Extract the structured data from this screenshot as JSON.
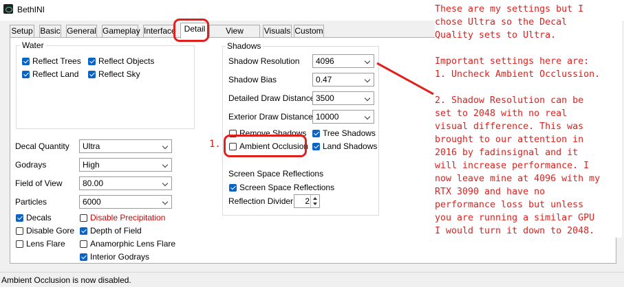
{
  "window": {
    "title": "BethINI",
    "close_glyph": "✕"
  },
  "tabs": [
    "Setup",
    "Basic",
    "General",
    "Gameplay",
    "Interface",
    "Detail",
    "View Distance",
    "Visuals",
    "Custom"
  ],
  "active_tab": "Detail",
  "water": {
    "title": "Water",
    "items": [
      {
        "label": "Reflect Trees",
        "checked": true
      },
      {
        "label": "Reflect Objects",
        "checked": true
      },
      {
        "label": "Reflect Land",
        "checked": true
      },
      {
        "label": "Reflect Sky",
        "checked": true
      }
    ]
  },
  "detail": {
    "decal_quantity": {
      "label": "Decal Quantity",
      "value": "Ultra"
    },
    "godrays": {
      "label": "Godrays",
      "value": "High"
    },
    "field_of_view": {
      "label": "Field of View",
      "value": "80.00"
    },
    "particles": {
      "label": "Particles",
      "value": "6000"
    }
  },
  "misc_checks": [
    {
      "label": "Decals",
      "checked": true
    },
    {
      "label": "Disable Precipitation",
      "checked": false
    },
    {
      "label": "Disable Gore",
      "checked": false
    },
    {
      "label": "Depth of Field",
      "checked": true
    },
    {
      "label": "Lens Flare",
      "checked": false
    },
    {
      "label": "Anamorphic Lens Flare",
      "checked": false
    },
    {
      "label": "Interior Godrays",
      "checked": true
    }
  ],
  "shadows": {
    "title": "Shadows",
    "resolution": {
      "label": "Shadow Resolution",
      "value": "4096"
    },
    "bias": {
      "label": "Shadow Bias",
      "value": "0.47"
    },
    "detailed_draw": {
      "label": "Detailed Draw Distance",
      "value": "3500"
    },
    "exterior_draw": {
      "label": "Exterior Draw Distance",
      "value": "10000"
    },
    "checks": [
      {
        "label": "Remove Shadows",
        "checked": false
      },
      {
        "label": "Tree Shadows",
        "checked": true
      },
      {
        "label": "Ambient Occlusion",
        "checked": false
      },
      {
        "label": "Land Shadows",
        "checked": true
      }
    ]
  },
  "ssr": {
    "title": "Screen Space Reflections",
    "check": {
      "label": "Screen Space Reflections",
      "checked": true
    },
    "divider": {
      "label": "Reflection Divider",
      "value": "2"
    }
  },
  "status": "Ambient Occlusion is now disabled.",
  "annotation": {
    "marker": "1.",
    "note": "These are my settings but I\nchose Ultra so the Decal\nQuality sets to Ultra.\n\nImportant settings here are:\n1. Uncheck Ambient Occlussion.\n\n2. Shadow Resolution can be\nset to 2048 with no real\nvisual difference. This was\nbrought to our attention in\n2016 by fadinsignal and it\nwill increase performance. I\nnow leave mine at 4096 with my\nRTX 3090 and have no\nperformance loss but unless\nyou are running a similar GPU\nI would turn it down to 2048.",
    "color": "#e0201c"
  }
}
